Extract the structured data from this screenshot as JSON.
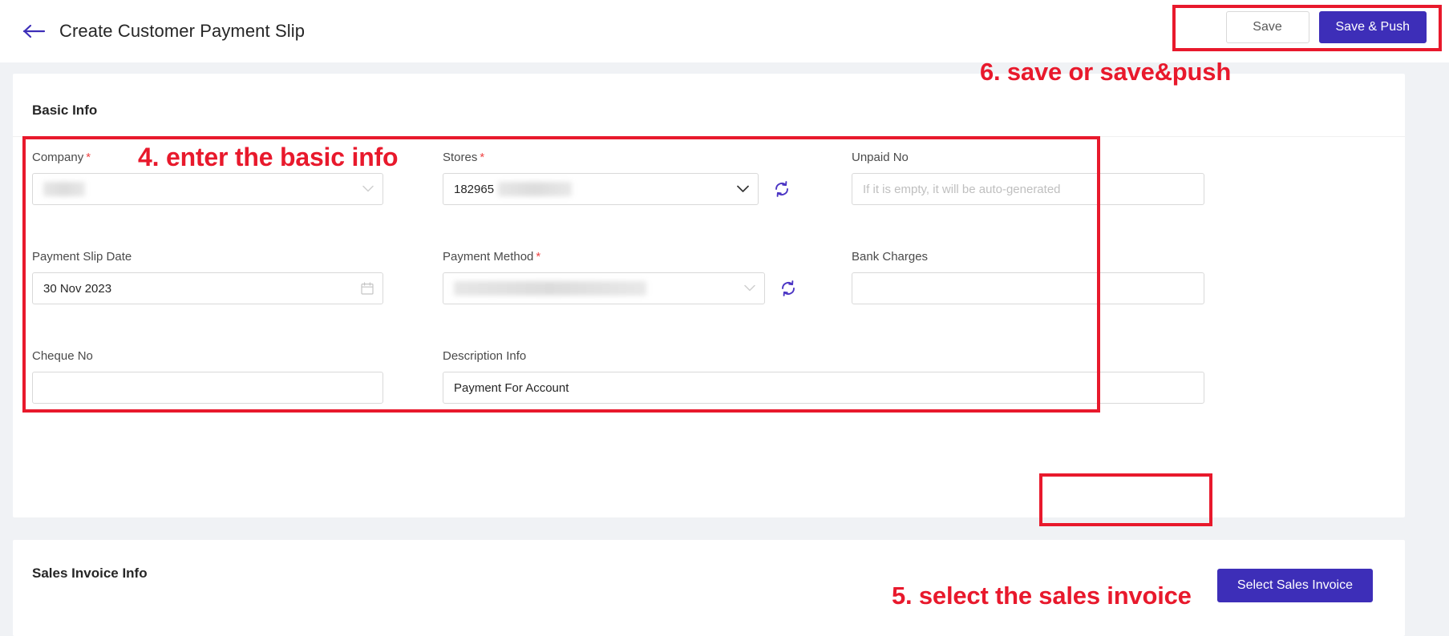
{
  "header": {
    "back_icon": "arrow-left-icon",
    "title": "Create Customer Payment Slip",
    "save_label": "Save",
    "save_push_label": "Save & Push"
  },
  "annotations": [
    {
      "id": "step-4",
      "text": "4. enter the basic info"
    },
    {
      "id": "step-5",
      "text": "5. select the sales invoice"
    },
    {
      "id": "step-6",
      "text": "6. save or save&push"
    }
  ],
  "annotation_color": "#e8192c",
  "theme": {
    "primary": "#3d2eb8",
    "required_asterisk": "#ef4444",
    "page_background": "#f0f2f5",
    "card_background": "#ffffff",
    "border": "#d9d9d9",
    "placeholder_text": "#bfbfbf"
  },
  "basic_info": {
    "title": "Basic Info",
    "fields": {
      "company": {
        "label": "Company",
        "required": true,
        "value": "",
        "redacted": true,
        "control": "select",
        "disabled": true
      },
      "stores": {
        "label": "Stores",
        "required": true,
        "value": "182965",
        "redacted_suffix": true,
        "control": "select",
        "has_refresh": true
      },
      "unpaid_no": {
        "label": "Unpaid No",
        "required": false,
        "value": "",
        "placeholder": "If it is empty, it will be auto-generated",
        "control": "text"
      },
      "payment_slip_date": {
        "label": "Payment Slip Date",
        "required": false,
        "value": "30 Nov 2023",
        "control": "date",
        "icon": "calendar-icon"
      },
      "payment_method": {
        "label": "Payment Method",
        "required": true,
        "value": "",
        "redacted": true,
        "control": "select",
        "has_refresh": true
      },
      "bank_charges": {
        "label": "Bank Charges",
        "required": false,
        "value": "",
        "control": "text"
      },
      "cheque_no": {
        "label": "Cheque No",
        "required": false,
        "value": "",
        "control": "text"
      },
      "description_info": {
        "label": "Description Info",
        "required": false,
        "value": "Payment For Account",
        "control": "text"
      }
    }
  },
  "sales_invoice_info": {
    "title": "Sales Invoice Info",
    "select_button_label": "Select Sales Invoice"
  }
}
